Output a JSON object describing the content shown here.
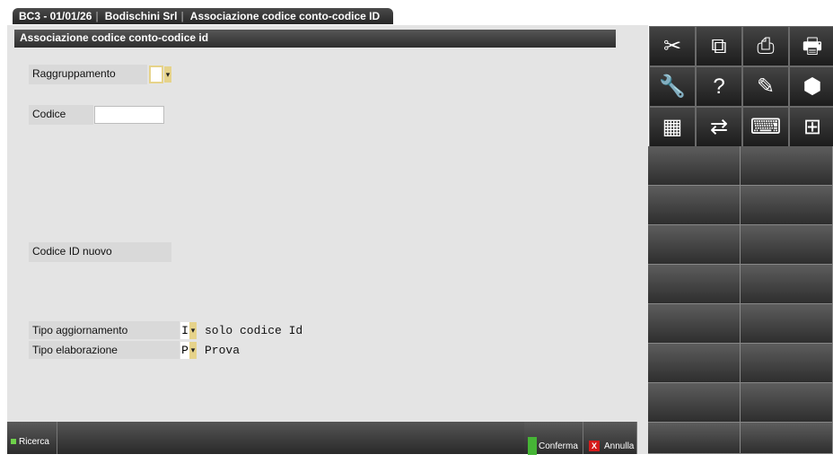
{
  "tab": {
    "company_code": "BC3 - 01/01/26",
    "company_name": "Bodischini Srl",
    "window_name": "Associazione codice conto-codice ID"
  },
  "form": {
    "title": "Associazione codice conto-codice id",
    "raggruppamento_label": "Raggruppamento",
    "raggruppamento_value": "",
    "codice_label": "Codice",
    "codice_value": "",
    "codice_id_nuovo_label": "Codice ID nuovo",
    "tipo_aggiornamento_label": "Tipo aggiornamento",
    "tipo_aggiornamento_value": "I",
    "tipo_aggiornamento_desc": "solo codice Id",
    "tipo_elaborazione_label": "Tipo elaborazione",
    "tipo_elaborazione_value": "P",
    "tipo_elaborazione_desc": "Prova"
  },
  "bottom_buttons": {
    "ricerca": "Ricerca",
    "conferma": "Conferma",
    "annulla": "Annulla"
  },
  "toolbar_icons": [
    "scissors-icon",
    "copy-document-icon",
    "print-preview-icon",
    "printer-icon",
    "wrench-icon",
    "help-question-icon",
    "notes-icon",
    "box-icon",
    "calculator-icon",
    "transfer-arrows-icon",
    "keyboard-icon",
    "grid-icon"
  ]
}
